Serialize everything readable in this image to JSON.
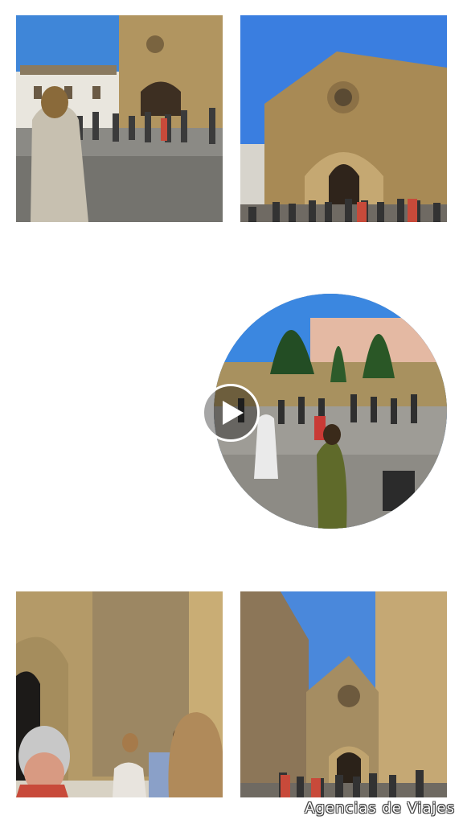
{
  "gallery": {
    "photos": [
      {
        "id": "photo-1",
        "subject": "guide-with-group-in-plaza"
      },
      {
        "id": "photo-2",
        "subject": "romanesque-church-facade"
      },
      {
        "id": "photo-4",
        "subject": "guide-in-stone-alley"
      },
      {
        "id": "photo-5",
        "subject": "street-view-toward-church"
      }
    ],
    "video": {
      "subject": "tour-group-in-square",
      "icon": "play-icon"
    }
  },
  "watermark": {
    "text": "Agencias de Viajes"
  },
  "colors": {
    "background": "#ffffff",
    "sky": "#3d7fd6",
    "stone": "#b69a66",
    "play_icon": "#ffffff"
  }
}
